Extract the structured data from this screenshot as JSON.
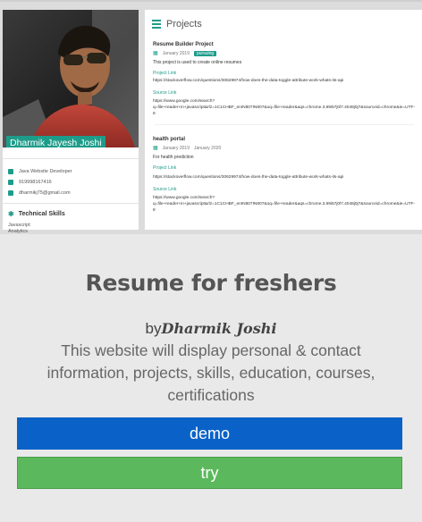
{
  "profile": {
    "name": "Dharmik Jayesh Joshi",
    "role": "Java Website Developer",
    "phone": "919998167416",
    "email": "dharmikj75@gmail.com"
  },
  "skills": {
    "heading": "Technical Skills",
    "items": [
      "Javascript",
      "Analytics"
    ]
  },
  "projects": {
    "heading": "Projects",
    "items": [
      {
        "name": "Resume Builder Project",
        "start": "January 2019",
        "badge": "pursuing",
        "description": "This project is used to create online resumes",
        "project_link_label": "Project Link",
        "project_link": "https://stackoverflow.com/questions/30629974/how-does-the-data-toggle-attribute-work-whats-its-api",
        "source_link_label": "Source Link",
        "source_link_1": "https://www.google.com/search?",
        "source_link_2": "q=file+reader+in+javascript&rlz=1C1CHBF_enIN807IN807&oq=file+reader&aqs=chrome.3.69i57j0l7.4048j0j7&sourceid=chrome&ie=UTF-",
        "source_link_3": "8"
      },
      {
        "name": "health portal",
        "start": "January 2019",
        "end": "January 2020",
        "description": "For health prediction",
        "project_link_label": "Project Link",
        "project_link": "https://stackoverflow.com/questions/30629974/how-does-the-data-toggle-attribute-work-whats-its-api",
        "source_link_label": "Source Link",
        "source_link_1": "https://www.google.com/search?",
        "source_link_2": "q=file+reader+in+javascript&rlz=1C1CHBF_enIN807IN807&oq=file+reader&aqs=chrome.3.69i57j0l7.4048j0j7&sourceid=chrome&ie=UTF-",
        "source_link_3": "8"
      }
    ]
  },
  "card": {
    "title": "Resume for freshers",
    "by": "by",
    "author": "Dharmik Joshi",
    "description": "This website will display personal & contact information, projects, skills, education, courses, certifications",
    "demo_label": "demo",
    "try_label": "try"
  },
  "colors": {
    "teal": "#1e9c8a",
    "demo": "#0a62c9",
    "try": "#5cb85c"
  }
}
